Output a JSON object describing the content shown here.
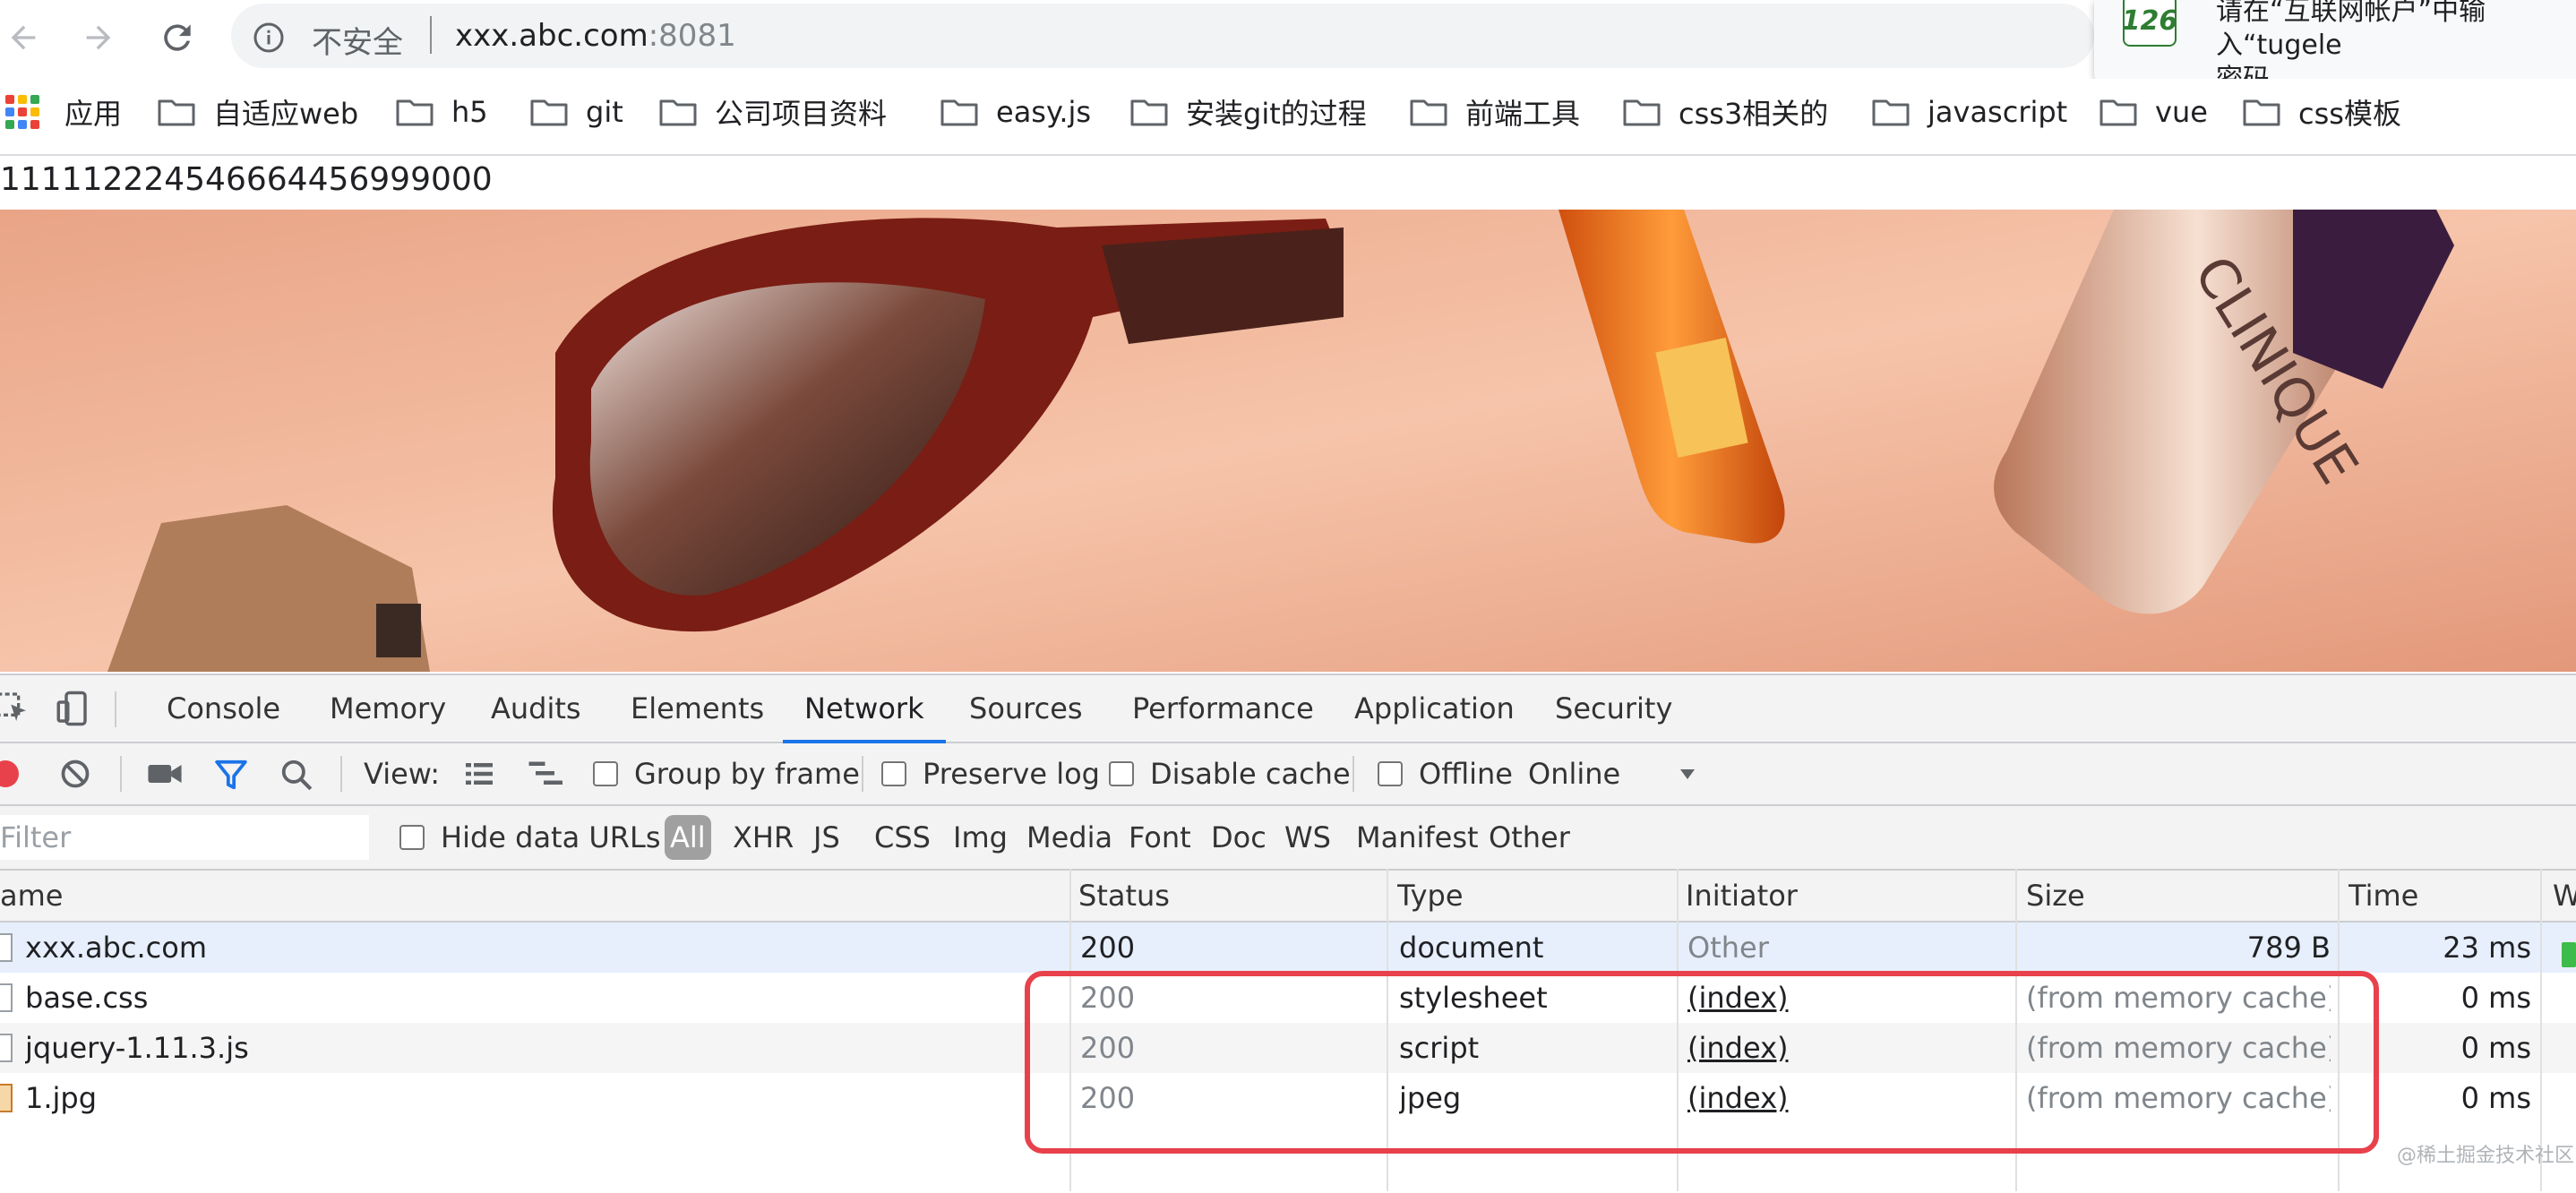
{
  "browser": {
    "omnibox": {
      "security_label": "不安全",
      "url_host": "xxx.abc.com",
      "url_port": ":8081"
    },
    "notification": {
      "logo_text": "126",
      "message": "请在“互联网帐户”中输入“tugele\n密码。"
    }
  },
  "bookmarks": {
    "apps_label": "应用",
    "apps_colors": [
      "#ea4335",
      "#fbbc04",
      "#34a853",
      "#4285f4",
      "#ea4335",
      "#fbbc04",
      "#34a853",
      "#4285f4",
      "#ea4335"
    ],
    "items": [
      {
        "label": "自适应web"
      },
      {
        "label": "h5"
      },
      {
        "label": "git"
      },
      {
        "label": "公司项目资料"
      },
      {
        "label": "easy.js"
      },
      {
        "label": "安装git的过程"
      },
      {
        "label": "前端工具"
      },
      {
        "label": "css3相关的"
      },
      {
        "label": "javascript"
      },
      {
        "label": "vue"
      },
      {
        "label": "css模板"
      }
    ]
  },
  "page": {
    "text": "111112224546664456999000"
  },
  "devtools": {
    "tabs": [
      "Console",
      "Memory",
      "Audits",
      "Elements",
      "Network",
      "Sources",
      "Performance",
      "Application",
      "Security"
    ],
    "active_tab": "Network",
    "toolbar": {
      "view_label": "View:",
      "group_by_frame": "Group by frame",
      "preserve_log": "Preserve log",
      "disable_cache": "Disable cache",
      "offline": "Offline",
      "throttling": "Online"
    },
    "filterbar": {
      "placeholder": "Filter",
      "hide_data_urls": "Hide data URLs",
      "types": [
        "All",
        "XHR",
        "JS",
        "CSS",
        "Img",
        "Media",
        "Font",
        "Doc",
        "WS",
        "Manifest",
        "Other"
      ],
      "active_type": "All"
    },
    "table": {
      "columns": [
        "ame",
        "Status",
        "Type",
        "Initiator",
        "Size",
        "Time",
        "W"
      ],
      "rows": [
        {
          "name": "xxx.abc.com",
          "status": "200",
          "type": "document",
          "initiator": "Other",
          "size": "789 B",
          "time": "23 ms"
        },
        {
          "name": "base.css",
          "status": "200",
          "type": "stylesheet",
          "initiator": "(index)",
          "size": "(from memory cache)",
          "time": "0 ms"
        },
        {
          "name": "jquery-1.11.3.js",
          "status": "200",
          "type": "script",
          "initiator": "(index)",
          "size": "(from memory cache)",
          "time": "0 ms"
        },
        {
          "name": "1.jpg",
          "status": "200",
          "type": "jpeg",
          "initiator": "(index)",
          "size": "(from memory cache)",
          "time": "0 ms"
        }
      ]
    },
    "watermark": "@稀土掘金技术社区"
  },
  "colors": {
    "accent": "#1a73e8",
    "record": "#e8414b",
    "highlight": "#e8414b",
    "filter_active": "#1a73e8"
  }
}
